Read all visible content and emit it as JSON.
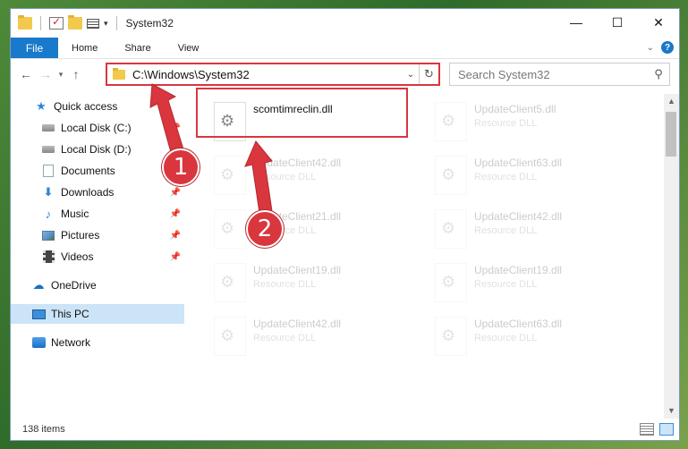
{
  "window": {
    "title": "System32",
    "controls": [
      "—",
      "☐",
      "✕"
    ]
  },
  "ribbon": {
    "tabs": [
      "File",
      "Home",
      "Share",
      "View"
    ],
    "help_label": "?"
  },
  "navigation": {
    "address": "C:\\Windows\\System32",
    "search_placeholder": "Search System32"
  },
  "sidebar": {
    "items": [
      {
        "label": "Quick access",
        "icon": "star-icon",
        "pinned": false
      },
      {
        "label": "Local Disk (C:)",
        "icon": "drive-icon",
        "pinned": true
      },
      {
        "label": "Local Disk (D:)",
        "icon": "drive-icon",
        "pinned": false
      },
      {
        "label": "Documents",
        "icon": "documents-icon",
        "pinned": true
      },
      {
        "label": "Downloads",
        "icon": "download-icon",
        "pinned": true
      },
      {
        "label": "Music",
        "icon": "music-icon",
        "pinned": true
      },
      {
        "label": "Pictures",
        "icon": "pictures-icon",
        "pinned": true
      },
      {
        "label": "Videos",
        "icon": "videos-icon",
        "pinned": true
      },
      {
        "label": "OneDrive",
        "icon": "cloud-icon",
        "pinned": false
      },
      {
        "label": "This PC",
        "icon": "computer-icon",
        "pinned": false,
        "selected": true
      },
      {
        "label": "Network",
        "icon": "network-icon",
        "pinned": false
      }
    ]
  },
  "files": [
    {
      "name": "scomtimreclin.dll",
      "type": "",
      "highlighted": true
    },
    {
      "name": "UpdateClient5.dll",
      "type": "Resource DLL"
    },
    {
      "name": "UpdateClient42.dll",
      "type": "Resource DLL"
    },
    {
      "name": "UpdateClient63.dll",
      "type": "Resource DLL"
    },
    {
      "name": "UpdateClient21.dll",
      "type": "Resource DLL"
    },
    {
      "name": "UpdateClient42.dll",
      "type": "Resource DLL"
    },
    {
      "name": "UpdateClient19.dll",
      "type": "Resource DLL"
    },
    {
      "name": "UpdateClient19.dll",
      "type": "Resource DLL"
    },
    {
      "name": "UpdateClient42.dll",
      "type": "Resource DLL"
    },
    {
      "name": "UpdateClient63.dll",
      "type": "Resource DLL"
    }
  ],
  "status": {
    "item_count": "138 items"
  },
  "annotations": {
    "step1": "1",
    "step2": "2",
    "color": "#d9363e"
  }
}
